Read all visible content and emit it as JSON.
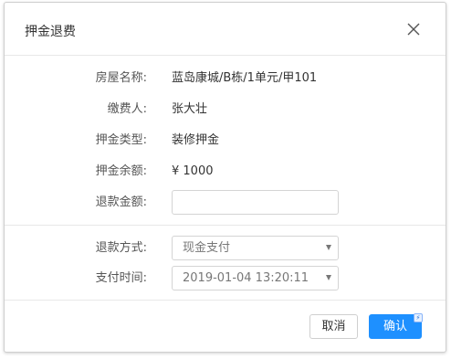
{
  "dialog": {
    "title": "押金退费",
    "close_icon": "close-icon"
  },
  "fields": {
    "house": {
      "label": "房屋名称:",
      "value": "蓝岛康城/B栋/1单元/甲101"
    },
    "payer": {
      "label": "缴费人:",
      "value": "张大壮"
    },
    "deposit_type": {
      "label": "押金类型:",
      "value": "装修押金"
    },
    "balance": {
      "label": "押金余额:",
      "value": "¥ 1000"
    },
    "refund_amount": {
      "label": "退款金额:",
      "value": "",
      "placeholder": ""
    }
  },
  "options": {
    "refund_method": {
      "label": "退款方式:",
      "selected": "现金支付"
    },
    "pay_time": {
      "label": "支付时间:",
      "selected": "2019-01-04 13:20:11"
    }
  },
  "footer": {
    "cancel_label": "取消",
    "confirm_label": "确认",
    "confirm_badge": "⚡"
  },
  "colors": {
    "primary": "#1e90ff",
    "border": "#d4d4d4"
  }
}
